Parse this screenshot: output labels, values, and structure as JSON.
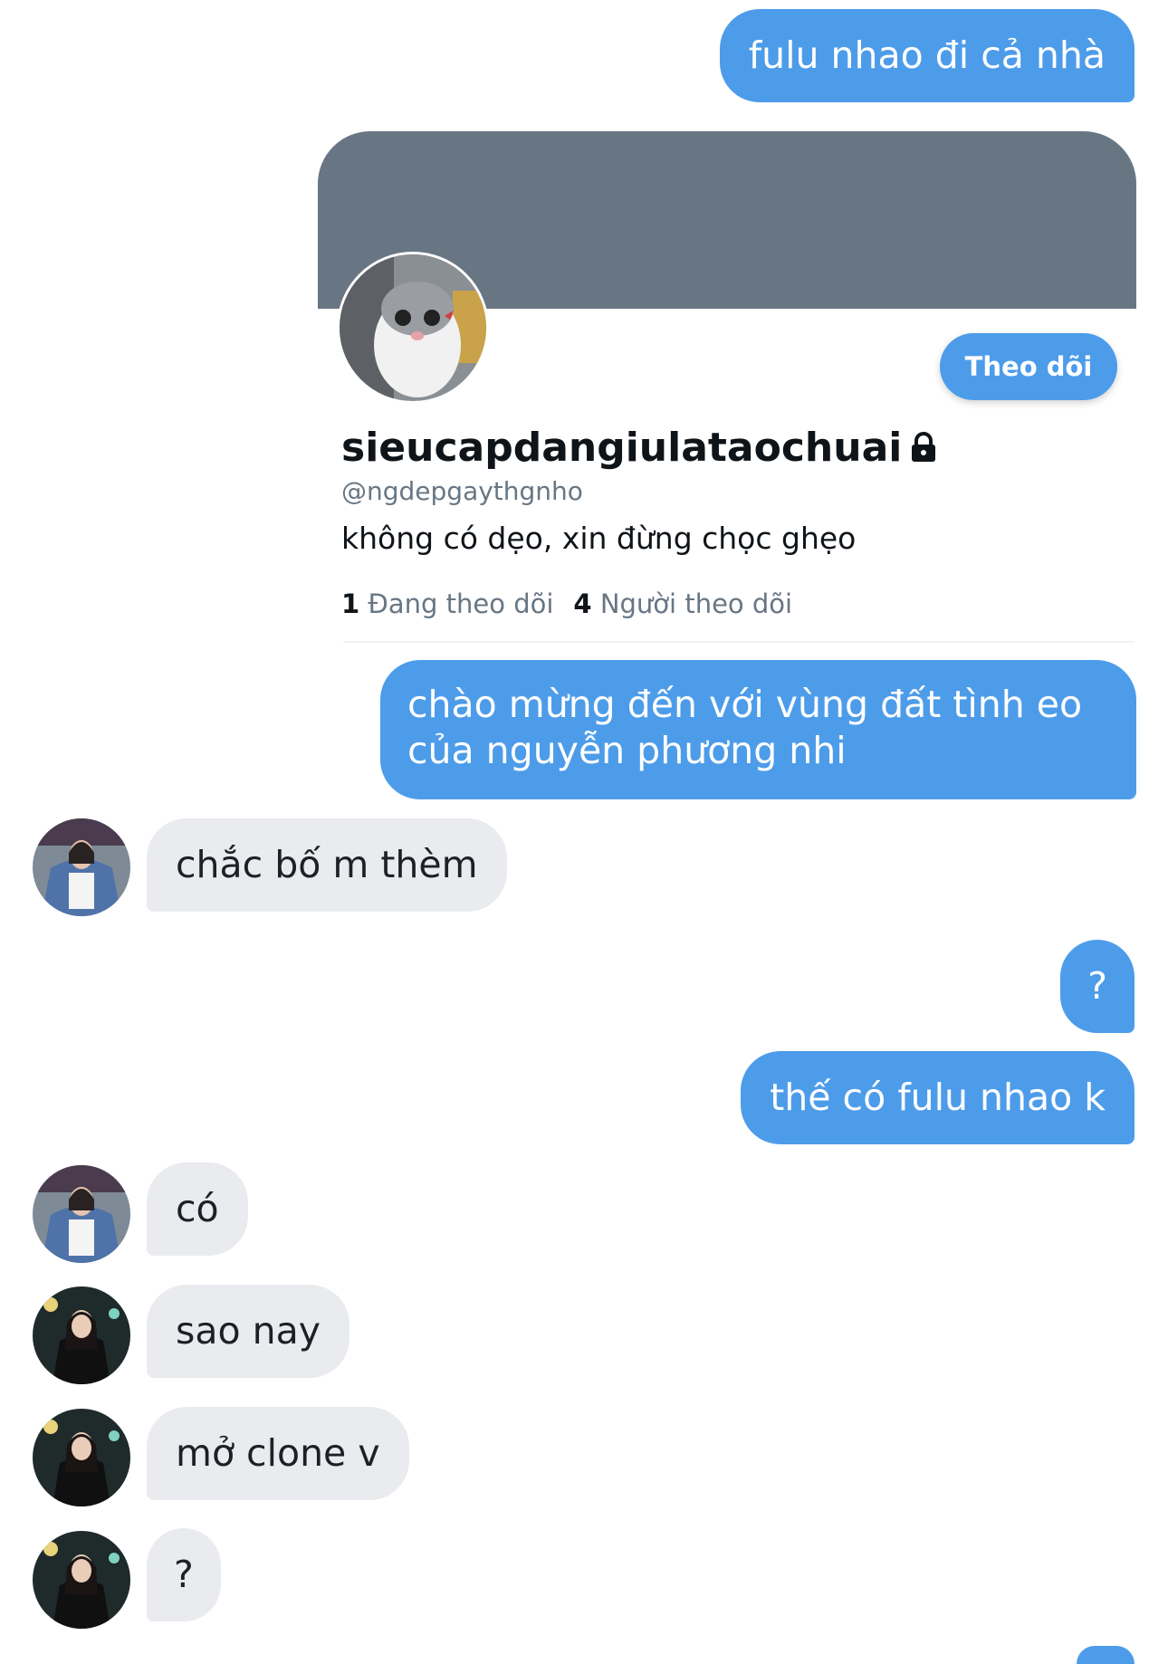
{
  "messages": {
    "m1": "fulu nhao đi cả nhà",
    "m2": "chào mừng đến với vùng đất tình eo\ncủa nguyễn phương nhi",
    "m3": "chắc bố m thèm",
    "m4": "?",
    "m5": "thế có fulu nhao k",
    "m6": "có",
    "m7": "sao nay",
    "m8": "mở clone v",
    "m9": "?"
  },
  "profile_card": {
    "display_name": "sieucapdangiulataochuai",
    "handle": "@ngdepgaythgnho",
    "bio": "không có dẹo, xin đừng chọc ghẹo",
    "following_count": "1",
    "following_label": "Đang theo dõi",
    "followers_count": "4",
    "followers_label": "Người theo dõi",
    "follow_button": "Theo dõi",
    "avatar_icon": "cat-avatar",
    "lock_icon": "lock-icon"
  },
  "colors": {
    "sent_bubble": "#4d9cea",
    "received_bubble": "#e9ebee",
    "banner": "#687684"
  }
}
